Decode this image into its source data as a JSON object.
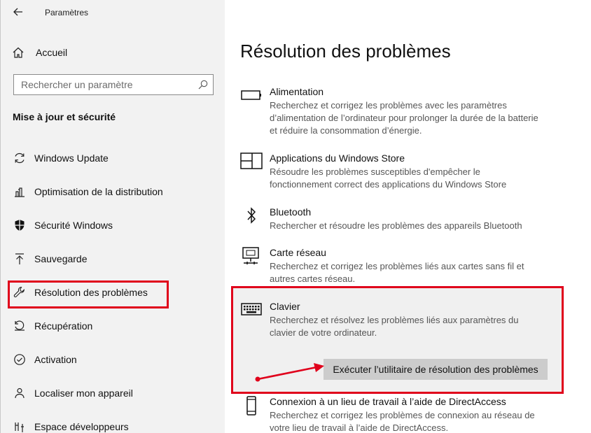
{
  "window": {
    "title": "Paramètres"
  },
  "sidebar": {
    "home_label": "Accueil",
    "search": {
      "placeholder": "Rechercher un paramètre"
    },
    "section_title": "Mise à jour et sécurité",
    "items": [
      {
        "label": "Windows Update",
        "icon": "refresh-icon"
      },
      {
        "label": "Optimisation de la distribution",
        "icon": "delivery-optimization-icon"
      },
      {
        "label": "Sécurité Windows",
        "icon": "shield-icon"
      },
      {
        "label": "Sauvegarde",
        "icon": "backup-upload-icon"
      },
      {
        "label": "Résolution des problèmes",
        "icon": "wrench-icon"
      },
      {
        "label": "Récupération",
        "icon": "recovery-icon"
      },
      {
        "label": "Activation",
        "icon": "check-circle-icon"
      },
      {
        "label": "Localiser mon appareil",
        "icon": "person-pin-icon"
      },
      {
        "label": "Espace développeurs",
        "icon": "developer-tools-icon"
      }
    ],
    "selected_index": 4
  },
  "main": {
    "title": "Résolution des problèmes",
    "troubleshooters": [
      {
        "name": "Alimentation",
        "icon": "battery-icon",
        "description": "Recherchez et corrigez les problèmes avec les paramètres d’alimentation de l’ordinateur pour prolonger la durée de la batterie et réduire la consommation d’énergie."
      },
      {
        "name": "Applications du Windows Store",
        "icon": "store-app-icon",
        "description": "Résoudre les problèmes susceptibles d'empêcher le fonctionnement correct des applications du Windows Store"
      },
      {
        "name": "Bluetooth",
        "icon": "bluetooth-icon",
        "description": "Rechercher et résoudre les problèmes des appareils Bluetooth"
      },
      {
        "name": "Carte réseau",
        "icon": "network-adapter-icon",
        "description": "Recherchez et corrigez les problèmes liés aux cartes sans fil et autres cartes réseau."
      },
      {
        "name": "Clavier",
        "icon": "keyboard-icon",
        "description": "Recherchez et résolvez les problèmes liés aux paramètres du clavier de votre ordinateur."
      },
      {
        "name": "Connexion à un lieu de travail à l’aide de DirectAccess",
        "icon": "phone-device-icon",
        "description": "Recherchez et corrigez les problèmes de connexion au réseau de votre lieu de travail à l’aide de DirectAccess."
      }
    ],
    "run_button_label": "Exécuter l’utilitaire de résolution des problèmes"
  },
  "colors": {
    "highlight_red": "#e0001b",
    "sidebar_bg": "#f2f2f2",
    "selected_panel_bg": "#f0f0f0",
    "button_bg": "#cccccc"
  }
}
